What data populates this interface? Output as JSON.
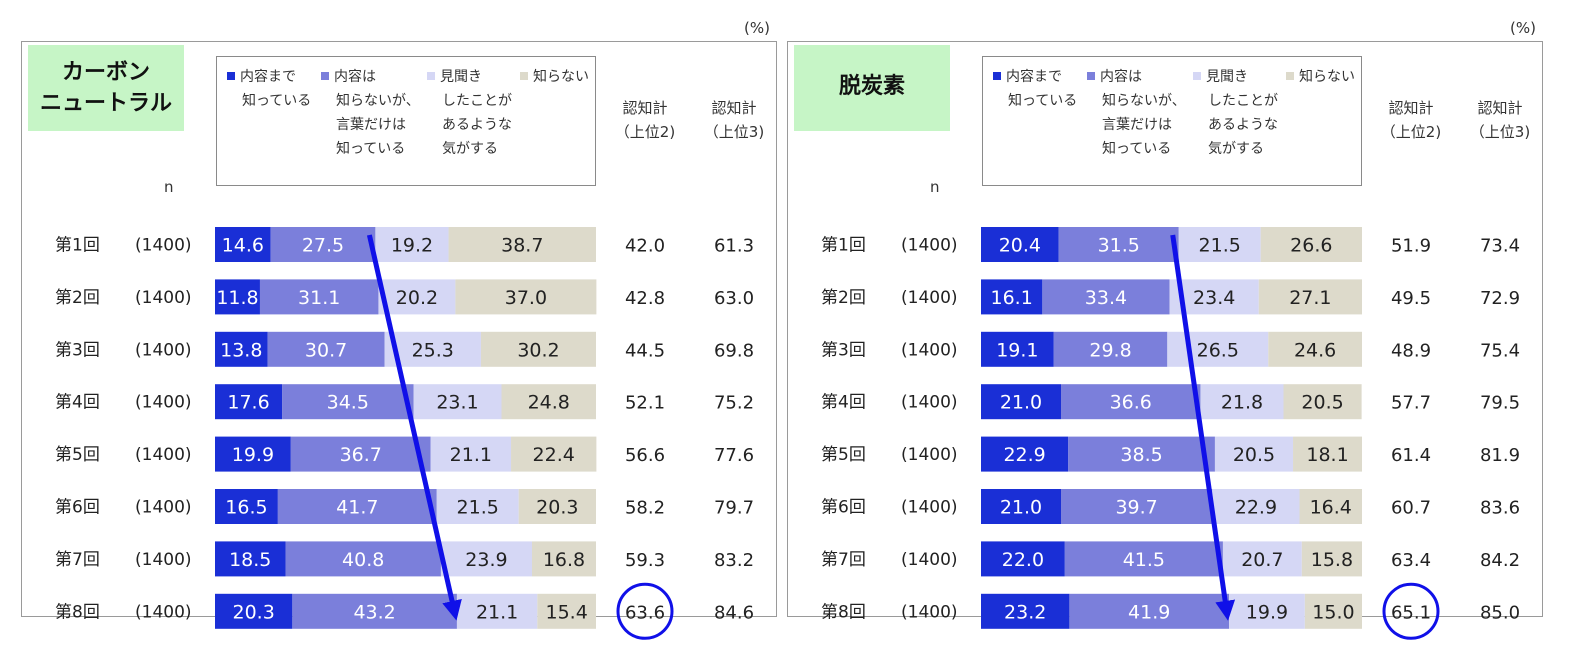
{
  "unit_label": "(%)",
  "legend_items": [
    {
      "lines": [
        "内容まで",
        "知っている"
      ],
      "color": "#1a2fd6"
    },
    {
      "lines": [
        "内容は",
        "知らないが、",
        "言葉だけは",
        "知っている"
      ],
      "color": "#7b7fdb"
    },
    {
      "lines": [
        "見聞き",
        "したことが",
        "あるような",
        "気がする"
      ],
      "color": "#d5d7f5"
    },
    {
      "lines": [
        "知らない"
      ],
      "color": "#dddacb"
    }
  ],
  "columns": {
    "n": "n",
    "top2": [
      "認知計",
      "（上位2)"
    ],
    "top3": [
      "認知計",
      "（上位3)"
    ]
  },
  "text_colors": {
    "dark_segment": "#ffffff",
    "light_segment": "#222222"
  },
  "arrow_color": "#1010e8",
  "circle_color": "#1010e8",
  "chart_data": [
    {
      "type": "bar",
      "orientation": "horizontal",
      "stacked": true,
      "title": "カーボン\nニュートラル",
      "categories": [
        "第1回",
        "第2回",
        "第3回",
        "第4回",
        "第5回",
        "第6回",
        "第7回",
        "第8回"
      ],
      "n": [
        "(1400)",
        "(1400)",
        "(1400)",
        "(1400)",
        "(1400)",
        "(1400)",
        "(1400)",
        "(1400)"
      ],
      "series": [
        {
          "name": "内容まで知っている",
          "values": [
            14.6,
            11.8,
            13.8,
            17.6,
            19.9,
            16.5,
            18.5,
            20.3
          ]
        },
        {
          "name": "内容は知らないが、言葉だけは知っている",
          "values": [
            27.5,
            31.1,
            30.7,
            34.5,
            36.7,
            41.7,
            40.8,
            43.2
          ]
        },
        {
          "name": "見聞きしたことがあるような気がする",
          "values": [
            19.2,
            20.2,
            25.3,
            23.1,
            21.1,
            21.5,
            23.9,
            21.1
          ]
        },
        {
          "name": "知らない",
          "values": [
            38.7,
            37.0,
            30.2,
            24.8,
            22.4,
            20.3,
            16.8,
            15.4
          ]
        }
      ],
      "top2": [
        42.0,
        42.8,
        44.5,
        52.1,
        56.6,
        58.2,
        59.3,
        63.6
      ],
      "top3": [
        61.3,
        63.0,
        69.8,
        75.2,
        77.6,
        79.7,
        83.2,
        84.6
      ],
      "xlim": [
        0,
        100
      ],
      "highlight": {
        "row": 7,
        "column": "top2"
      },
      "trend_arrow": {
        "from_row": 0,
        "to_row": 7,
        "series_boundary": 2
      }
    },
    {
      "type": "bar",
      "orientation": "horizontal",
      "stacked": true,
      "title": "脱炭素",
      "categories": [
        "第1回",
        "第2回",
        "第3回",
        "第4回",
        "第5回",
        "第6回",
        "第7回",
        "第8回"
      ],
      "n": [
        "(1400)",
        "(1400)",
        "(1400)",
        "(1400)",
        "(1400)",
        "(1400)",
        "(1400)",
        "(1400)"
      ],
      "series": [
        {
          "name": "内容まで知っている",
          "values": [
            20.4,
            16.1,
            19.1,
            21.0,
            22.9,
            21.0,
            22.0,
            23.2
          ]
        },
        {
          "name": "内容は知らないが、言葉だけは知っている",
          "values": [
            31.5,
            33.4,
            29.8,
            36.6,
            38.5,
            39.7,
            41.5,
            41.9
          ]
        },
        {
          "name": "見聞きしたことがあるような気がする",
          "values": [
            21.5,
            23.4,
            26.5,
            21.8,
            20.5,
            22.9,
            20.7,
            19.9
          ]
        },
        {
          "name": "知らない",
          "values": [
            26.6,
            27.1,
            24.6,
            20.5,
            18.1,
            16.4,
            15.8,
            15.0
          ]
        }
      ],
      "top2": [
        51.9,
        49.5,
        48.9,
        57.7,
        61.4,
        60.7,
        63.4,
        65.1
      ],
      "top3": [
        73.4,
        72.9,
        75.4,
        79.5,
        81.9,
        83.6,
        84.2,
        85.0
      ],
      "xlim": [
        0,
        100
      ],
      "highlight": {
        "row": 7,
        "column": "top2"
      },
      "trend_arrow": {
        "from_row": 0,
        "to_row": 7,
        "series_boundary": 2
      }
    }
  ]
}
